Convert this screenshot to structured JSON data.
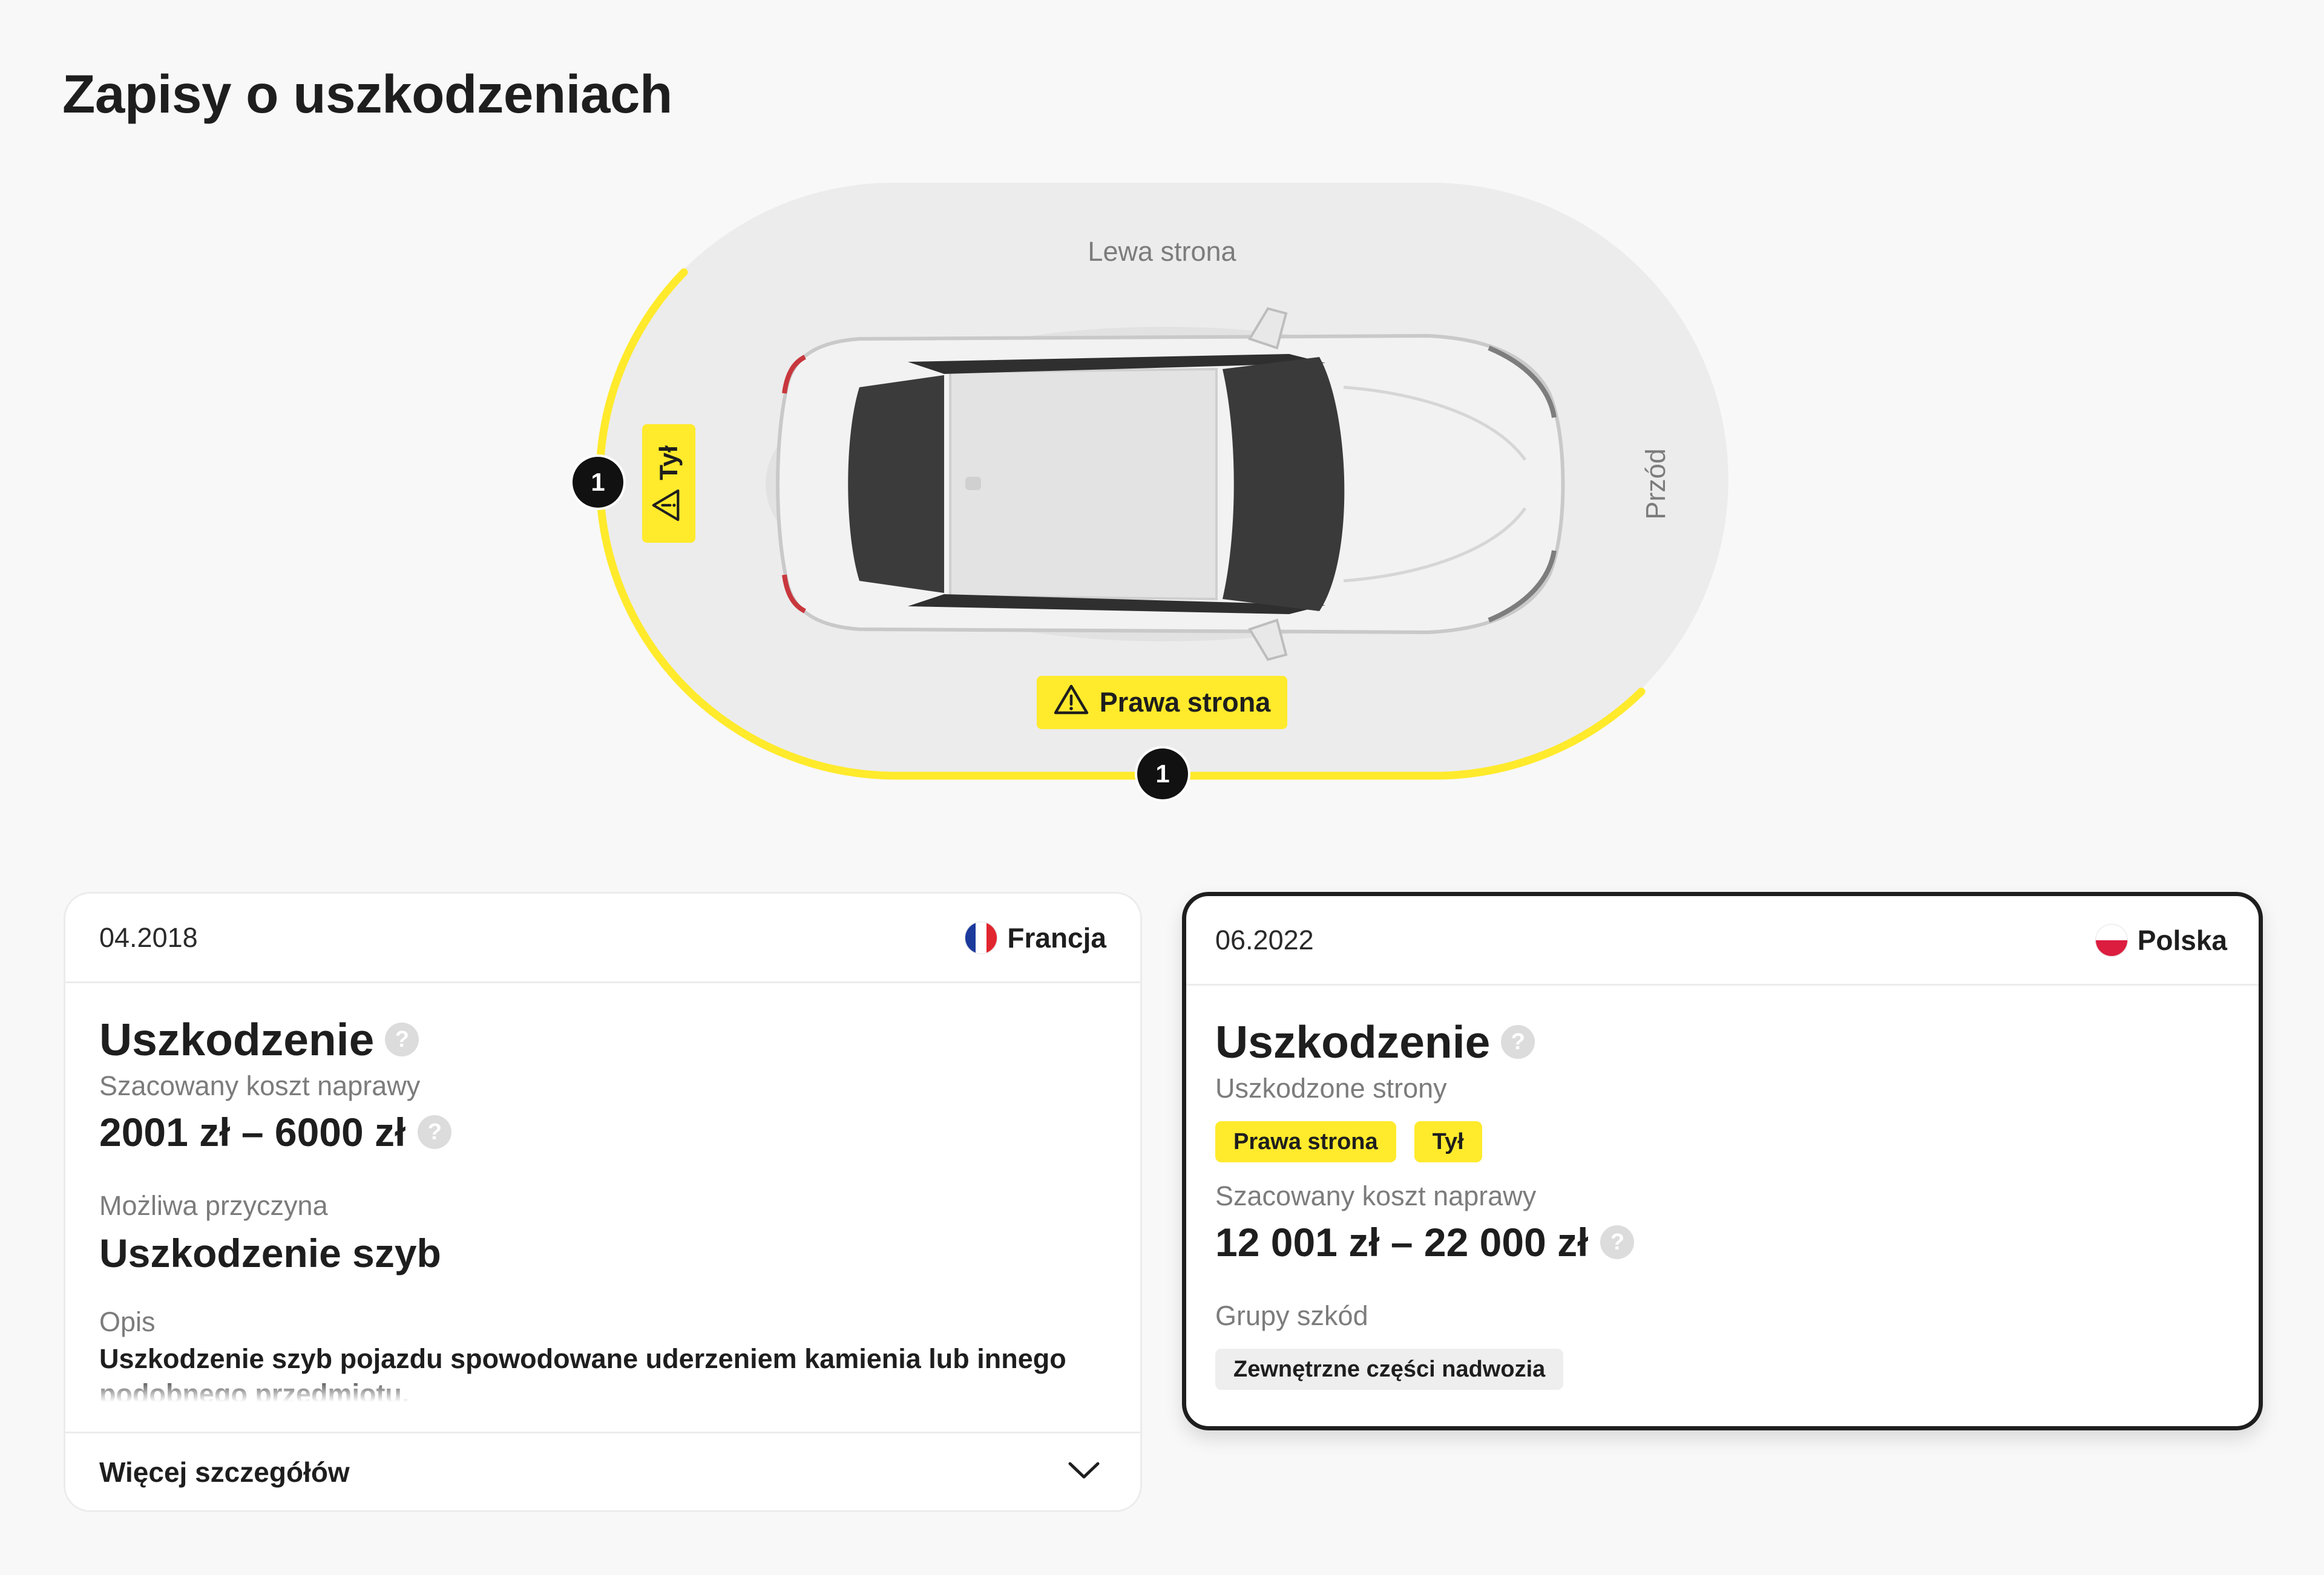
{
  "page": {
    "title": "Zapisy o uszkodzeniach"
  },
  "diagram": {
    "left_side_label": "Lewa strona",
    "front_label": "Przód",
    "tags": {
      "right_side": "Prawa strona",
      "rear": "Tył"
    },
    "badges": {
      "rear_count": "1",
      "right_side_count": "1"
    },
    "highlight_color": "#ffea2c"
  },
  "records": [
    {
      "date": "04.2018",
      "country": "Francja",
      "flag_icon": "flag-france-icon",
      "title": "Uszkodzenie",
      "cost_label": "Szacowany koszt naprawy",
      "cost_value": "2001 zł – 6000 zł",
      "cause_label": "Możliwa przyczyna",
      "cause_value": "Uszkodzenie szyb",
      "description_label": "Opis",
      "description": "Uszkodzenie szyb pojazdu spowodowane uderzeniem kamienia lub innego podobnego przedmiotu.",
      "more_label": "Więcej szczegółów"
    },
    {
      "date": "06.2022",
      "country": "Polska",
      "flag_icon": "flag-poland-icon",
      "title": "Uszkodzenie",
      "sides_label": "Uszkodzone strony",
      "sides": [
        "Prawa strona",
        "Tył"
      ],
      "cost_label": "Szacowany koszt naprawy",
      "cost_value": "12 001 zł – 22 000 zł",
      "groups_label": "Grupy szkód",
      "groups": [
        "Zewnętrzne części nadwozia"
      ]
    }
  ],
  "colors": {
    "accent_yellow": "#ffea2c",
    "help_icon_grey": "#dcdcdc",
    "text_dark": "#1e1e1e",
    "text_muted": "#7c7c7c"
  }
}
